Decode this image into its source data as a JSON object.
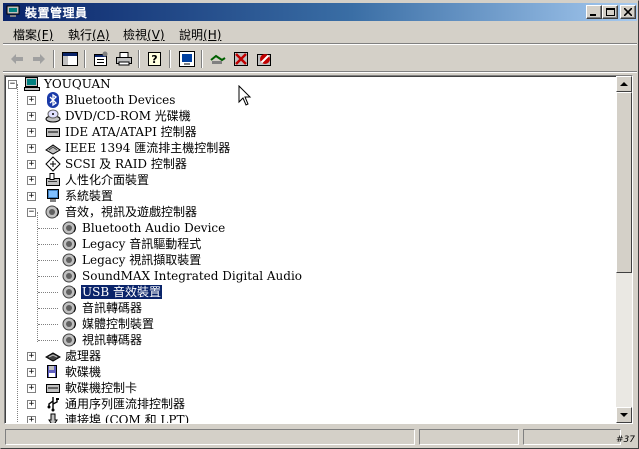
{
  "window": {
    "title": "裝置管理員",
    "minimize": "_",
    "maximize": "□",
    "close": "×"
  },
  "menu": {
    "items": [
      {
        "label": "檔案",
        "mnemonic": "(F)"
      },
      {
        "label": "執行",
        "mnemonic": "(A)"
      },
      {
        "label": "檢視",
        "mnemonic": "(V)"
      },
      {
        "label": "說明",
        "mnemonic": "(H)"
      }
    ]
  },
  "toolbar": {
    "icons": [
      "back-arrow-icon",
      "forward-arrow-icon",
      "console-tree-icon",
      "properties-icon",
      "print-icon",
      "help-icon",
      "computer-monitor-icon",
      "scan-hardware-icon",
      "uninstall-icon",
      "disable-icon"
    ]
  },
  "tree": {
    "root": "YOUQUAN",
    "nodes": [
      {
        "label": "Bluetooth Devices",
        "icon": "bluetooth-icon"
      },
      {
        "label": "DVD/CD-ROM 光碟機",
        "icon": "cdrom-icon"
      },
      {
        "label": "IDE ATA/ATAPI 控制器",
        "icon": "ide-controller-icon"
      },
      {
        "label": "IEEE 1394 匯流排主機控制器",
        "icon": "ieee1394-icon"
      },
      {
        "label": "SCSI 及 RAID 控制器",
        "icon": "scsi-icon"
      },
      {
        "label": "人性化介面裝置",
        "icon": "hid-icon"
      },
      {
        "label": "系統裝置",
        "icon": "system-device-icon"
      },
      {
        "label": "音效，視訊及遊戲控制器",
        "icon": "sound-icon",
        "expanded": true,
        "children": [
          {
            "label": "Bluetooth Audio Device"
          },
          {
            "label": "Legacy 音訊驅動程式"
          },
          {
            "label": "Legacy 視訊擷取裝置"
          },
          {
            "label": "SoundMAX Integrated Digital Audio"
          },
          {
            "label": "USB 音效裝置",
            "selected": true
          },
          {
            "label": "音訊轉碼器"
          },
          {
            "label": "媒體控制裝置"
          },
          {
            "label": "視訊轉碼器"
          }
        ]
      },
      {
        "label": "處理器",
        "icon": "processor-icon"
      },
      {
        "label": "軟碟機",
        "icon": "floppy-drive-icon"
      },
      {
        "label": "軟碟機控制卡",
        "icon": "floppy-controller-icon"
      },
      {
        "label": "通用序列匯流排控制器",
        "icon": "usb-icon"
      },
      {
        "label": "連接埠 (COM 和 LPT)",
        "icon": "port-icon"
      }
    ]
  },
  "statusbar": {
    "grip": "#37"
  },
  "colors": {
    "titlebar_start": "#0a246a",
    "titlebar_end": "#a6caf0",
    "face": "#d4d0c8",
    "selection": "#0a246a"
  }
}
